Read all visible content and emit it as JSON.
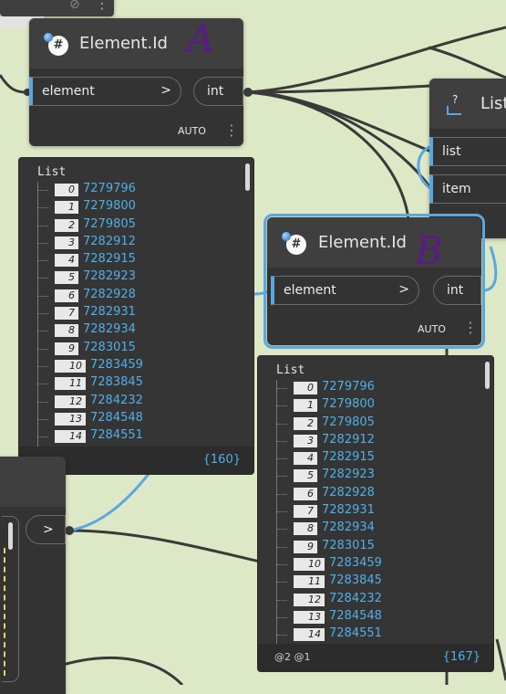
{
  "colors": {
    "accent": "#5aa7e0",
    "value_text": "#4fb0e8",
    "annotation": "#5b1a86",
    "canvas": "#dde8c6"
  },
  "node_a": {
    "title": "Element.Id",
    "annotation": "A",
    "icon": "element-id-icon",
    "icon_glyph": "#",
    "input_label": "element",
    "input_arrow": ">",
    "output_label": "int",
    "lacing": "AUTO"
  },
  "node_b": {
    "title": "Element.Id",
    "annotation": "B",
    "icon": "element-id-icon",
    "icon_glyph": "#",
    "input_label": "element",
    "input_arrow": ">",
    "output_label": "int",
    "lacing": "AUTO"
  },
  "list_node": {
    "title": "List",
    "inputs": [
      "list",
      "item"
    ],
    "icon": "list-icon",
    "icon_glyph": "?"
  },
  "bottom_left_node": {
    "output_arrow": ">"
  },
  "top_stub": {
    "icon": "eye-hidden-icon",
    "icon_glyph": "⊘"
  },
  "preview_a": {
    "title": "List",
    "items": [
      {
        "index": "0",
        "value": "7279796"
      },
      {
        "index": "1",
        "value": "7279800"
      },
      {
        "index": "2",
        "value": "7279805"
      },
      {
        "index": "3",
        "value": "7282912"
      },
      {
        "index": "4",
        "value": "7282915"
      },
      {
        "index": "5",
        "value": "7282923"
      },
      {
        "index": "6",
        "value": "7282928"
      },
      {
        "index": "7",
        "value": "7282931"
      },
      {
        "index": "8",
        "value": "7282934"
      },
      {
        "index": "9",
        "value": "7283015"
      },
      {
        "index": "10",
        "value": "7283459"
      },
      {
        "index": "11",
        "value": "7283845"
      },
      {
        "index": "12",
        "value": "7284232"
      },
      {
        "index": "13",
        "value": "7284548"
      },
      {
        "index": "14",
        "value": "7284551"
      }
    ],
    "count": "{160}"
  },
  "preview_b": {
    "title": "List",
    "items": [
      {
        "index": "0",
        "value": "7279796"
      },
      {
        "index": "1",
        "value": "7279800"
      },
      {
        "index": "2",
        "value": "7279805"
      },
      {
        "index": "3",
        "value": "7282912"
      },
      {
        "index": "4",
        "value": "7282915"
      },
      {
        "index": "5",
        "value": "7282923"
      },
      {
        "index": "6",
        "value": "7282928"
      },
      {
        "index": "7",
        "value": "7282931"
      },
      {
        "index": "8",
        "value": "7282934"
      },
      {
        "index": "9",
        "value": "7283015"
      },
      {
        "index": "10",
        "value": "7283459"
      },
      {
        "index": "11",
        "value": "7283845"
      },
      {
        "index": "12",
        "value": "7284232"
      },
      {
        "index": "13",
        "value": "7284548"
      },
      {
        "index": "14",
        "value": "7284551"
      }
    ],
    "levels": "@2 @1",
    "count": "{167}"
  }
}
